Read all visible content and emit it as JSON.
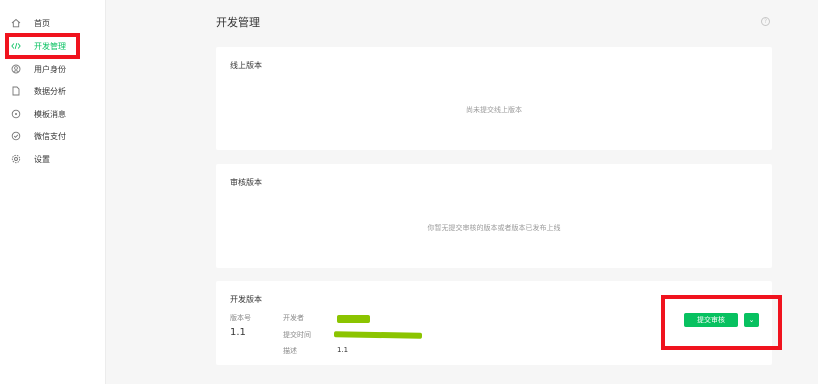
{
  "sidebar": {
    "items": [
      {
        "label": "首页",
        "icon": "home-icon"
      },
      {
        "label": "开发管理",
        "icon": "code-icon",
        "active": true
      },
      {
        "label": "用户身份",
        "icon": "user-icon"
      },
      {
        "label": "数据分析",
        "icon": "document-icon"
      },
      {
        "label": "模板消息",
        "icon": "message-icon"
      },
      {
        "label": "微信支付",
        "icon": "check-circle-icon"
      },
      {
        "label": "设置",
        "icon": "gear-icon"
      }
    ]
  },
  "header": {
    "title": "开发管理",
    "help_glyph": "?"
  },
  "online": {
    "title": "线上版本",
    "empty": "尚未提交线上版本"
  },
  "review": {
    "title": "审核版本",
    "empty": "你暂无提交审核的版本或者版本已发布上线"
  },
  "dev": {
    "title": "开发版本",
    "version_label": "版本号",
    "version_value": "1.1",
    "developer_label": "开发者",
    "submit_time_label": "提交时间",
    "description_label": "描述",
    "description_value": "1.1",
    "submit_button": "提交审核",
    "more_glyph": "⌄"
  },
  "colors": {
    "accent": "#07c160",
    "highlight": "#f0131e",
    "scribble": "#8bc400"
  }
}
